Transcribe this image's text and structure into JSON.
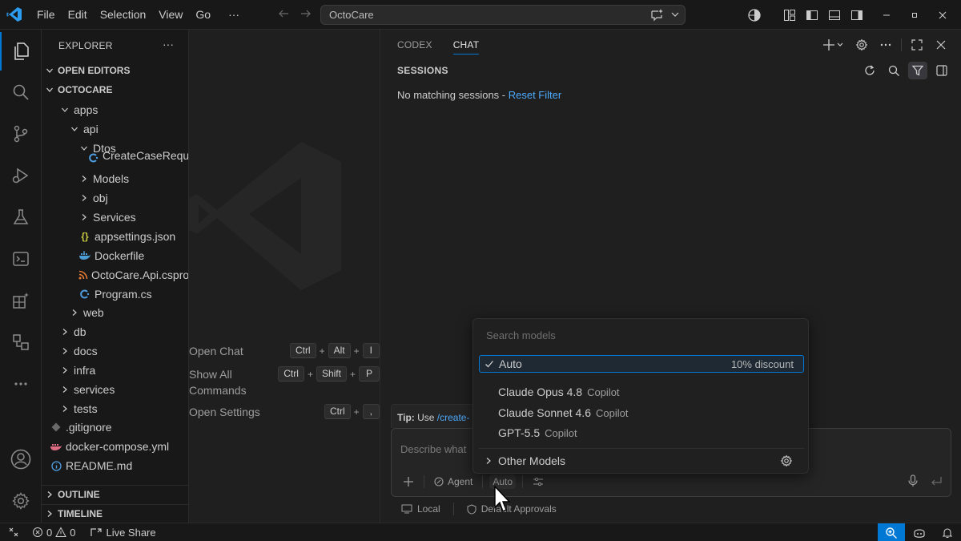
{
  "titlebar": {
    "menu": [
      "File",
      "Edit",
      "Selection",
      "View",
      "Go"
    ],
    "more": "···",
    "search_text": "OctoCare"
  },
  "sidebar": {
    "title": "EXPLORER",
    "more": "···",
    "open_editors": "OPEN EDITORS",
    "workspace": "OCTOCARE",
    "tree": [
      {
        "label": "apps",
        "icon": "chevron-down"
      },
      {
        "label": "api",
        "icon": "chevron-down"
      },
      {
        "label": "Dtos",
        "icon": "chevron-down"
      },
      {
        "label": "CreateCaseReque...",
        "icon": "csharp"
      },
      {
        "label": "Models",
        "icon": "chevron-right"
      },
      {
        "label": "obj",
        "icon": "chevron-right"
      },
      {
        "label": "Services",
        "icon": "chevron-right"
      },
      {
        "label": "appsettings.json",
        "icon": "json"
      },
      {
        "label": "Dockerfile",
        "icon": "docker"
      },
      {
        "label": "OctoCare.Api.csproj",
        "icon": "rss"
      },
      {
        "label": "Program.cs",
        "icon": "csharp"
      },
      {
        "label": "web",
        "icon": "chevron-right"
      },
      {
        "label": "db",
        "icon": "chevron-right"
      },
      {
        "label": "docs",
        "icon": "chevron-right"
      },
      {
        "label": "infra",
        "icon": "chevron-right"
      },
      {
        "label": "services",
        "icon": "chevron-right"
      },
      {
        "label": "tests",
        "icon": "chevron-right"
      },
      {
        "label": ".gitignore",
        "icon": "git"
      },
      {
        "label": "docker-compose.yml",
        "icon": "compose"
      },
      {
        "label": "README.md",
        "icon": "info"
      }
    ],
    "outline": "OUTLINE",
    "timeline": "TIMELINE"
  },
  "editor": {
    "shortcuts": [
      {
        "label": "Open Chat",
        "keys": [
          "Ctrl",
          "Alt",
          "I"
        ]
      },
      {
        "label": "Show All\nCommands",
        "label1": "Show All",
        "label2": "Commands",
        "keys": [
          "Ctrl",
          "Shift",
          "P"
        ]
      },
      {
        "label": "Open Settings",
        "keys": [
          "Ctrl",
          ","
        ]
      }
    ],
    "plus": "+"
  },
  "chat": {
    "tabs": [
      "CODEX",
      "CHAT"
    ],
    "active_tab": "CHAT",
    "sessions_title": "SESSIONS",
    "no_match": "No matching sessions - ",
    "reset_filter": "Reset Filter",
    "tip_label": "Tip:",
    "tip_text": " Use ",
    "tip_link": "/create-",
    "input_placeholder": "Describe what",
    "agent": "Agent",
    "model": "Auto",
    "local": "Local",
    "approvals": "Default Approvals"
  },
  "picker": {
    "search_placeholder": "Search models",
    "items": [
      {
        "name": "Auto",
        "sub": "",
        "right": "10% discount",
        "selected": true
      },
      {
        "name": "Claude Opus 4.8",
        "sub": "Copilot"
      },
      {
        "name": "Claude Sonnet 4.6",
        "sub": "Copilot"
      },
      {
        "name": "GPT-5.5",
        "sub": "Copilot"
      }
    ],
    "other": "Other Models"
  },
  "statusbar": {
    "errors": "0",
    "warnings": "0",
    "live_share": "Live Share"
  },
  "colors": {
    "accent": "#0078d4",
    "link": "#4daafc"
  }
}
